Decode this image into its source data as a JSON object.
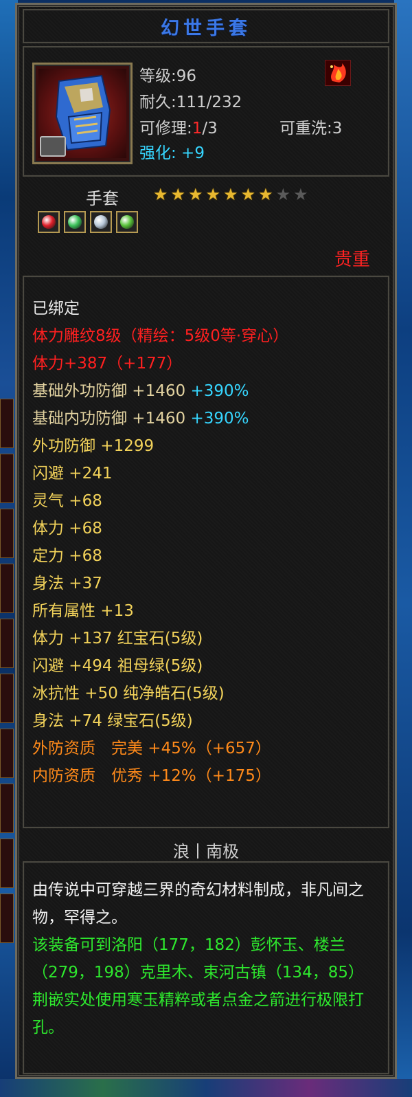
{
  "item": {
    "title": "幻世手套",
    "level_text": "等级:96",
    "durability_text": "耐久:111/232",
    "repair_prefix": "可修理:",
    "repair_used": "1",
    "repair_total": "/3",
    "rewash_text": "可重洗:3",
    "enhance_text": "强化: +9",
    "type": "手套",
    "stars": {
      "filled": 7,
      "total": 9
    },
    "sockets": [
      {
        "name": "ruby-gem",
        "color": "#e0202a"
      },
      {
        "name": "emerald-gem",
        "color": "#3cc25a"
      },
      {
        "name": "diamond-gem",
        "color": "#b8c8d8"
      },
      {
        "name": "green-jade-gem",
        "color": "#58c23a"
      }
    ],
    "rarity_label": "贵重"
  },
  "stats": {
    "bound": "已绑定",
    "engrave": "体力雕纹8级（精绘：5级0等·穿心）",
    "vit_bonus": "体力+387（+177）",
    "base_ext_def_label": "基础外功防御 +1460",
    "base_ext_def_pct": "+390%",
    "base_int_def_label": "基础内功防御 +1460",
    "base_int_def_pct": "+390%",
    "ext_def": "外功防御 +1299",
    "dodge": "闪避 +241",
    "spirit": "灵气 +68",
    "vitality": "体力 +68",
    "focus": "定力 +68",
    "agility": "身法 +37",
    "all_attr": "所有属性 +13",
    "gem_vit": "体力 +137 红宝石(5级)",
    "gem_dodge": "闪避 +494 祖母绿(5级)",
    "gem_ice": "冰抗性 +50 纯净皓石(5级)",
    "gem_agility": "身法 +74 绿宝石(5级)",
    "ext_quality": "外防资质　完美 +45%（+657）",
    "int_quality": "内防资质　优秀 +12%（+175）"
  },
  "server": "浪丨南极",
  "description": {
    "lore": "由传说中可穿越三界的奇幻材料制成，非凡间之物，罕得之。",
    "hint": "该装备可到洛阳（177，182）彭怀玉、楼兰（279，198）克里木、束河古镇（134，85）荆嵌实处使用寒玉精粹或者点金之箭进行极限打孔。"
  },
  "colors": {
    "title": "#3b78e8",
    "rare_red": "#ff2020",
    "stat_yellow": "#f2d25a",
    "quality_orange": "#ff8a1a",
    "percent_cyan": "#36d6ff",
    "hint_green": "#2ee82e"
  }
}
